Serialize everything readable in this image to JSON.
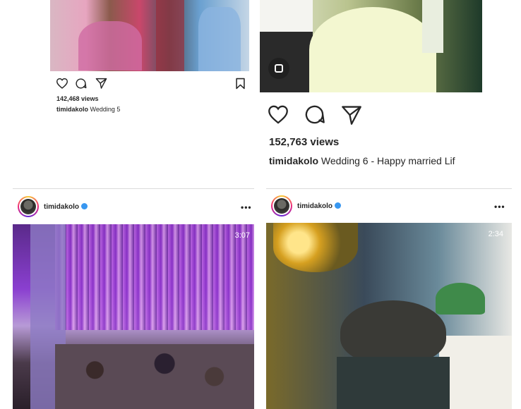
{
  "post1": {
    "views": "142,468 views",
    "username": "timidakolo",
    "caption": "Wedding 5"
  },
  "post2": {
    "views": "152,763 views",
    "username": "timidakolo",
    "caption": "Wedding 6 - Happy married Lif"
  },
  "post3": {
    "username": "timidakolo",
    "duration": "3:07",
    "more": "•••"
  },
  "post4": {
    "username": "timidakolo",
    "duration": "2:34",
    "more": "•••"
  },
  "icons": [
    "heart-icon",
    "comment-icon",
    "share-icon",
    "bookmark-icon",
    "verified-icon",
    "more-options-icon",
    "reels-icon"
  ],
  "colors": {
    "text": "#262626",
    "verified": "#3897f0",
    "divider": "#dbdbdb"
  }
}
